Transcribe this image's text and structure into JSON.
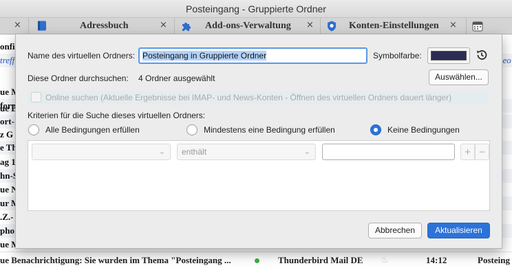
{
  "window": {
    "title": "Posteingang - Gruppierte Ordner"
  },
  "tabs": [
    {
      "label": "Adressbuch",
      "icon": "address-book-icon"
    },
    {
      "label": "Add-ons-Verwaltung",
      "icon": "puzzle-piece-icon"
    },
    {
      "label": "Konten-Einstellungen",
      "icon": "shield-icon"
    }
  ],
  "tab_close_glyph": "×",
  "background_list": {
    "header_fragment": "treff",
    "left_fragments": [
      "onfi",
      "ue M",
      "form",
      "ue B",
      "ort-",
      "z G",
      "e Th",
      "ag 1",
      "hn-S",
      "ue N",
      "ur M",
      ".Z.-",
      "pho",
      "ue M",
      "form"
    ],
    "right_fragment": "neo",
    "bottom_row": {
      "subject": "ue Benachrichtigung: Sie wurden im Thema \"Posteingang ...",
      "sender": "Thunderbird Mail DE",
      "time": "14:12",
      "folder": "Posteing"
    }
  },
  "dialog": {
    "name_label": "Name des virtuellen Ordners:",
    "name_value": "Posteingang in Gruppierte Ordner",
    "color_label": "Symbolfarbe:",
    "color_value": "#2b2d52",
    "search_label": "Diese Ordner durchsuchen:",
    "search_value": "4 Ordner ausgewählt",
    "choose_button": "Auswählen...",
    "online_search": {
      "label": "Online suchen (Aktuelle Ergebnisse bei IMAP- und News-Konten - Öffnen des virtuellen Ordners dauert länger)",
      "checked": false,
      "disabled": true
    },
    "criteria_label": "Kriterien für die Suche dieses virtuellen Ordners:",
    "match_options": [
      {
        "label": "Alle Bedingungen erfüllen",
        "selected": false
      },
      {
        "label": "Mindestens eine Bedingung erfüllen",
        "selected": false
      },
      {
        "label": "Keine Bedingungen",
        "selected": true
      }
    ],
    "condition": {
      "field": "",
      "operator": "enthält",
      "value": ""
    },
    "add_glyph": "+",
    "remove_glyph": "−",
    "cancel_button": "Abbrechen",
    "update_button": "Aktualisieren"
  },
  "colors": {
    "accent": "#2c73d9",
    "selection": "#b2d2fb",
    "focus": "#5c98e6"
  }
}
